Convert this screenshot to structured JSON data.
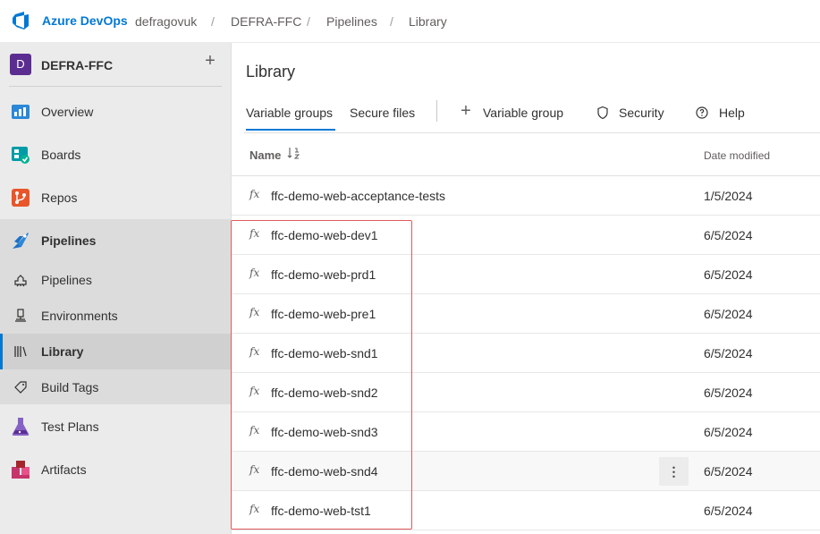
{
  "topbar": {
    "brand": "Azure DevOps",
    "breadcrumbs": [
      "defragovuk",
      "DEFRA-FFC",
      "Pipelines",
      "Library"
    ],
    "separator": "/"
  },
  "sidebar": {
    "project": {
      "initial": "D",
      "name": "DEFRA-FFC",
      "add": "+",
      "avatar_color": "#5c2d91"
    },
    "items": [
      {
        "label": "Overview",
        "icon": "overview-icon"
      },
      {
        "label": "Boards",
        "icon": "boards-icon"
      },
      {
        "label": "Repos",
        "icon": "repos-icon"
      },
      {
        "label": "Pipelines",
        "icon": "pipelines-icon"
      },
      {
        "label": "Pipelines",
        "icon": "rocket-icon"
      },
      {
        "label": "Environments",
        "icon": "environments-icon"
      },
      {
        "label": "Library",
        "icon": "library-icon"
      },
      {
        "label": "Build Tags",
        "icon": "tag-icon"
      },
      {
        "label": "Test Plans",
        "icon": "test-plans-icon"
      },
      {
        "label": "Artifacts",
        "icon": "artifacts-icon"
      }
    ]
  },
  "main": {
    "title": "Library",
    "tabs": [
      "Variable groups",
      "Secure files"
    ],
    "toolbar": {
      "add_variable_group": "Variable group",
      "security": "Security",
      "help": "Help"
    },
    "columns": {
      "name": "Name",
      "date": "Date modified"
    },
    "fx_label": "fx",
    "more_label": "⋮",
    "rows": [
      {
        "name": "ffc-demo-web-acceptance-tests",
        "date": "1/5/2024"
      },
      {
        "name": "ffc-demo-web-dev1",
        "date": "6/5/2024"
      },
      {
        "name": "ffc-demo-web-prd1",
        "date": "6/5/2024"
      },
      {
        "name": "ffc-demo-web-pre1",
        "date": "6/5/2024"
      },
      {
        "name": "ffc-demo-web-snd1",
        "date": "6/5/2024"
      },
      {
        "name": "ffc-demo-web-snd2",
        "date": "6/5/2024"
      },
      {
        "name": "ffc-demo-web-snd3",
        "date": "6/5/2024"
      },
      {
        "name": "ffc-demo-web-snd4",
        "date": "6/5/2024"
      },
      {
        "name": "ffc-demo-web-tst1",
        "date": "6/5/2024"
      }
    ]
  },
  "colors": {
    "accent": "#0078d4",
    "highlight": "#e05a5a"
  }
}
